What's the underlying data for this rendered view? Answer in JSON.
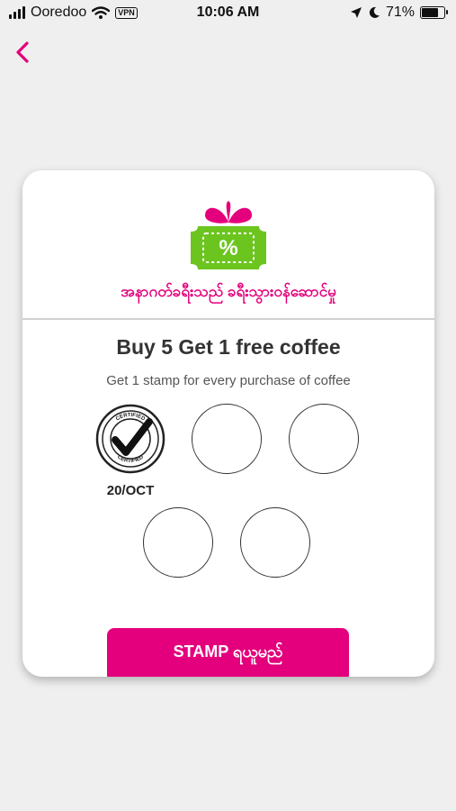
{
  "status_bar": {
    "carrier": "Ooredoo",
    "vpn_label": "VPN",
    "time": "10:06 AM",
    "battery": "71%",
    "battery_level": 0.71,
    "icons": [
      "signal-icon",
      "wifi-icon",
      "location-icon",
      "moon-icon",
      "battery-icon"
    ]
  },
  "nav": {
    "back_icon": "chevron-left-icon"
  },
  "card": {
    "icon": "gift-discount-icon",
    "icon_symbol": "%",
    "subtitle": "အနာဂတ်ခရီးသည် ခရီးသွားဝန်ဆောင်မှု",
    "title": "Buy 5 Get 1 free coffee",
    "description": "Get 1 stamp for every purchase of coffee",
    "stamps": [
      {
        "filled": true,
        "badge_text": "CERTIFIED",
        "date": "20/OCT"
      },
      {
        "filled": false
      },
      {
        "filled": false
      },
      {
        "filled": false
      },
      {
        "filled": false
      }
    ],
    "button_label": "STAMP ရယူမည်"
  },
  "colors": {
    "accent": "#e4007c",
    "gift_green": "#6cc51f",
    "background": "#efefef"
  }
}
